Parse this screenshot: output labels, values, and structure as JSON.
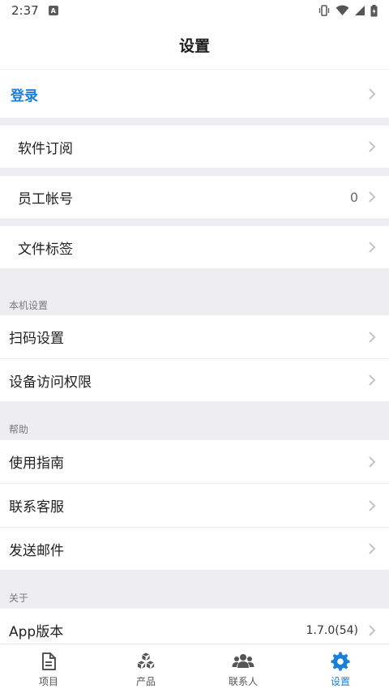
{
  "status_bar": {
    "time": "2:37",
    "notif_icon": "a-icon"
  },
  "app_bar": {
    "title": "设置"
  },
  "login": {
    "label": "登录",
    "color": "#1a7fd9"
  },
  "groups": {
    "software_subscription": "软件订阅",
    "staff_accounts": {
      "label": "员工帐号",
      "value": "0"
    },
    "file_tags": "文件标签"
  },
  "local_settings": {
    "title": "本机设置",
    "items": [
      "扫码设置",
      "设备访问权限"
    ]
  },
  "help": {
    "title": "帮助",
    "items": [
      "使用指南",
      "联系客服",
      "发送邮件"
    ]
  },
  "about": {
    "title": "关于",
    "app_version": {
      "label": "App版本",
      "value": "1.7.0(54)"
    }
  },
  "bottom_nav": {
    "items": [
      {
        "label": "项目",
        "icon": "document-icon"
      },
      {
        "label": "产品",
        "icon": "boxes-icon"
      },
      {
        "label": "联系人",
        "icon": "people-icon"
      },
      {
        "label": "设置",
        "icon": "gear-icon",
        "active": true
      }
    ]
  },
  "colors": {
    "accent": "#1a7fd9",
    "background": "#ededf2"
  }
}
